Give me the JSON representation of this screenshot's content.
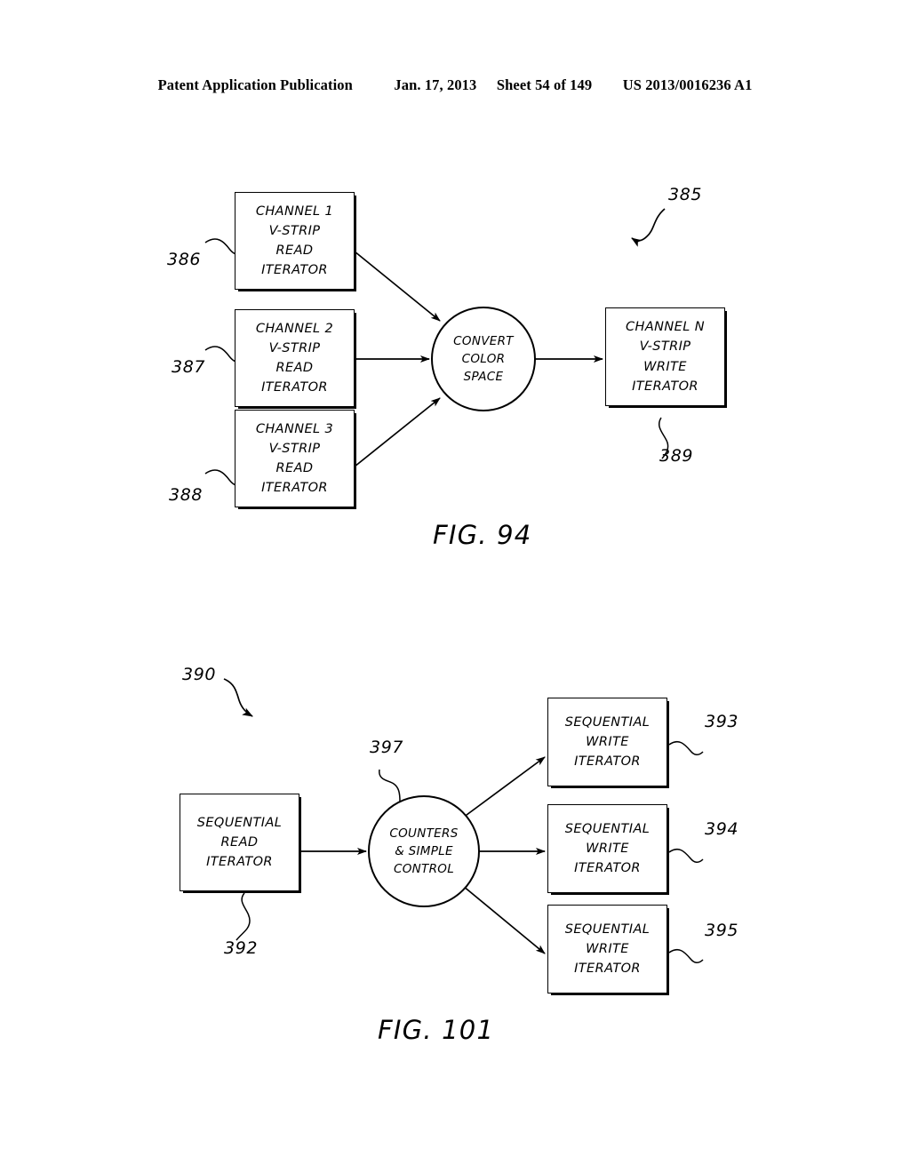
{
  "header": {
    "publication": "Patent Application Publication",
    "date": "Jan. 17, 2013",
    "sheet": "Sheet 54 of 149",
    "number": "US 2013/0016236 A1"
  },
  "figures": [
    {
      "id": "fig-94",
      "caption": "FIG. 94",
      "assembly_ref": "385",
      "nodes": [
        {
          "name": "channel-1-read-iterator",
          "ref": "386",
          "shape": "rect",
          "lines": [
            "CHANNEL 1",
            "V-STRIP",
            "READ",
            "ITERATOR"
          ]
        },
        {
          "name": "channel-2-read-iterator",
          "ref": "387",
          "shape": "rect",
          "lines": [
            "CHANNEL 2",
            "V-STRIP",
            "READ",
            "ITERATOR"
          ]
        },
        {
          "name": "channel-3-read-iterator",
          "ref": "388",
          "shape": "rect",
          "lines": [
            "CHANNEL 3",
            "V-STRIP",
            "READ",
            "ITERATOR"
          ]
        },
        {
          "name": "convert-color-space",
          "ref": "",
          "shape": "circle",
          "lines": [
            "CONVERT",
            "COLOR",
            "SPACE"
          ]
        },
        {
          "name": "channel-n-write-iterator",
          "ref": "389",
          "shape": "rect",
          "lines": [
            "CHANNEL N",
            "V-STRIP",
            "WRITE",
            "ITERATOR"
          ]
        }
      ]
    },
    {
      "id": "fig-101",
      "caption": "FIG. 101",
      "assembly_ref": "390",
      "nodes": [
        {
          "name": "sequential-read-iterator",
          "ref": "392",
          "shape": "rect",
          "lines": [
            "SEQUENTIAL",
            "READ",
            "ITERATOR"
          ]
        },
        {
          "name": "counters-and-simple-control",
          "ref": "397",
          "shape": "circle",
          "lines": [
            "COUNTERS",
            "& SIMPLE",
            "CONTROL"
          ]
        },
        {
          "name": "sequential-write-iterator-1",
          "ref": "393",
          "shape": "rect",
          "lines": [
            "SEQUENTIAL",
            "WRITE",
            "ITERATOR"
          ]
        },
        {
          "name": "sequential-write-iterator-2",
          "ref": "394",
          "shape": "rect",
          "lines": [
            "SEQUENTIAL",
            "WRITE",
            "ITERATOR"
          ]
        },
        {
          "name": "sequential-write-iterator-3",
          "ref": "395",
          "shape": "rect",
          "lines": [
            "SEQUENTIAL",
            "WRITE",
            "ITERATOR"
          ]
        }
      ]
    }
  ]
}
